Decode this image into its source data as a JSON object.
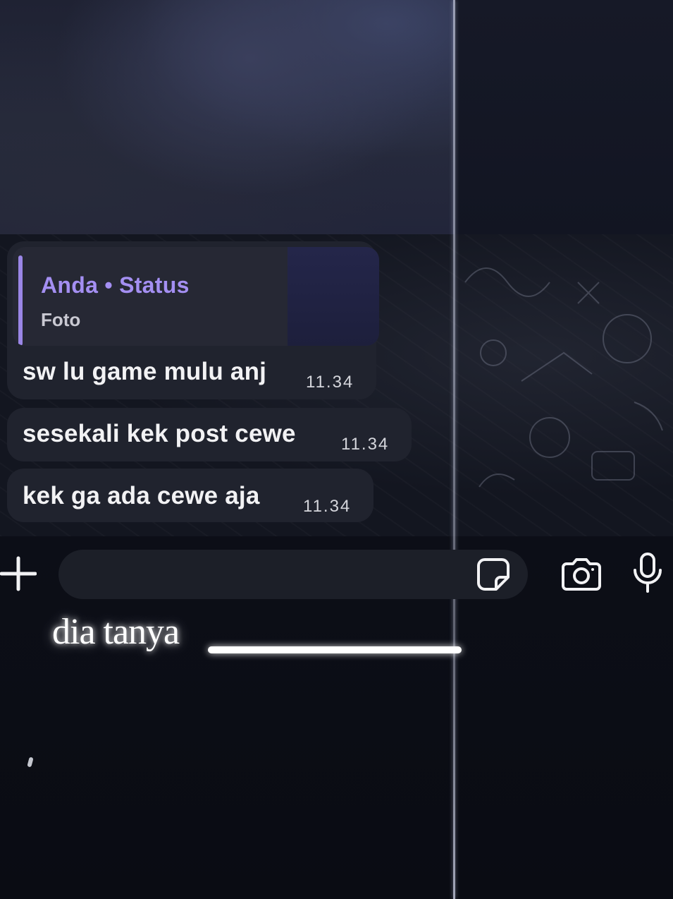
{
  "quoted_reply": {
    "title": "Anda • Status",
    "subtitle": "Foto"
  },
  "messages": [
    {
      "text": "sw lu game mulu anj",
      "time": "11.34"
    },
    {
      "text": "sesekali kek post cewe",
      "time": "11.34"
    },
    {
      "text": "kek ga ada cewe aja",
      "time": "11.34"
    }
  ],
  "composer": {
    "placeholder": "",
    "icons": [
      "plus-icon",
      "sticker-icon",
      "camera-icon",
      "microphone-icon"
    ]
  },
  "caption": {
    "text": "dia tanya"
  },
  "colors": {
    "accent": "#a48ff2",
    "bubble": "#20232e",
    "background": "#0b0d15"
  }
}
